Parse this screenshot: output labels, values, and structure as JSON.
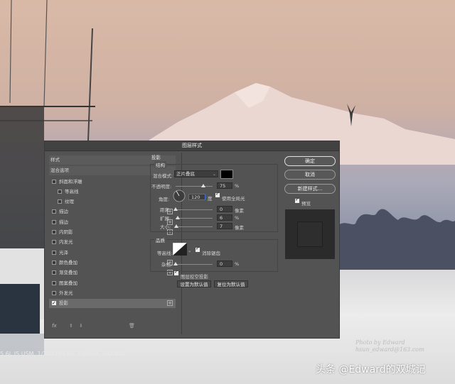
{
  "photo": {
    "caption": "5.6L IS USM, 1/200 (f/5.6), 300mm, ISO 400",
    "signature_line1": "Photo by Edward",
    "signature_line2": "hsun_edward@163.com",
    "watermark": "头条 @Edward的双城记"
  },
  "dialog": {
    "title": "图层样式",
    "left_panel": {
      "items": [
        {
          "label": "样式",
          "checkbox": false,
          "checked": false,
          "plus": false,
          "indent": 0,
          "header": true
        },
        {
          "label": "混合选项",
          "checkbox": false,
          "checked": false,
          "plus": false,
          "indent": 0,
          "header": true
        },
        {
          "label": "斜面和浮雕",
          "checkbox": true,
          "checked": false,
          "plus": false,
          "indent": 0
        },
        {
          "label": "等高线",
          "checkbox": true,
          "checked": false,
          "plus": false,
          "indent": 1
        },
        {
          "label": "纹理",
          "checkbox": true,
          "checked": false,
          "plus": false,
          "indent": 1
        },
        {
          "label": "描边",
          "checkbox": true,
          "checked": false,
          "plus": true,
          "indent": 0
        },
        {
          "label": "描边",
          "checkbox": true,
          "checked": false,
          "plus": true,
          "indent": 0
        },
        {
          "label": "内阴影",
          "checkbox": true,
          "checked": false,
          "plus": true,
          "indent": 0
        },
        {
          "label": "内发光",
          "checkbox": true,
          "checked": false,
          "plus": false,
          "indent": 0
        },
        {
          "label": "光泽",
          "checkbox": true,
          "checked": false,
          "plus": false,
          "indent": 0
        },
        {
          "label": "颜色叠加",
          "checkbox": true,
          "checked": false,
          "plus": true,
          "indent": 0
        },
        {
          "label": "渐变叠加",
          "checkbox": true,
          "checked": false,
          "plus": true,
          "indent": 0
        },
        {
          "label": "图案叠加",
          "checkbox": true,
          "checked": false,
          "plus": false,
          "indent": 0
        },
        {
          "label": "外发光",
          "checkbox": true,
          "checked": false,
          "plus": false,
          "indent": 0
        },
        {
          "label": "投影",
          "checkbox": true,
          "checked": true,
          "plus": true,
          "indent": 0,
          "selected": true
        }
      ],
      "footer_fx": "fx"
    },
    "drop_shadow": {
      "section_title": "投影",
      "structure_title": "结构",
      "blend_mode_label": "混合模式:",
      "blend_mode_value": "正片叠底",
      "shadow_color": "#000000",
      "opacity_label": "不透明度:",
      "opacity_value": "75",
      "opacity_unit": "%",
      "angle_label": "角度:",
      "angle_value": "120",
      "angle_unit": "度",
      "global_light_label": "使用全局光",
      "global_light_checked": true,
      "distance_label": "距离:",
      "distance_value": "0",
      "distance_unit": "像素",
      "spread_label": "扩展:",
      "spread_value": "6",
      "spread_unit": "%",
      "size_label": "大小:",
      "size_value": "7",
      "size_unit": "像素",
      "quality_title": "品质",
      "contour_label": "等高线:",
      "antialias_label": "消除锯齿",
      "antialias_checked": true,
      "noise_label": "杂色:",
      "noise_value": "0",
      "noise_unit": "%",
      "knockout_label": "图层挖空投影",
      "knockout_checked": true,
      "make_default_label": "设置为默认值",
      "reset_default_label": "复位为默认值"
    },
    "buttons": {
      "ok": "确定",
      "cancel": "取消",
      "new_style": "新建样式...",
      "preview_label": "预览",
      "preview_checked": true
    }
  }
}
